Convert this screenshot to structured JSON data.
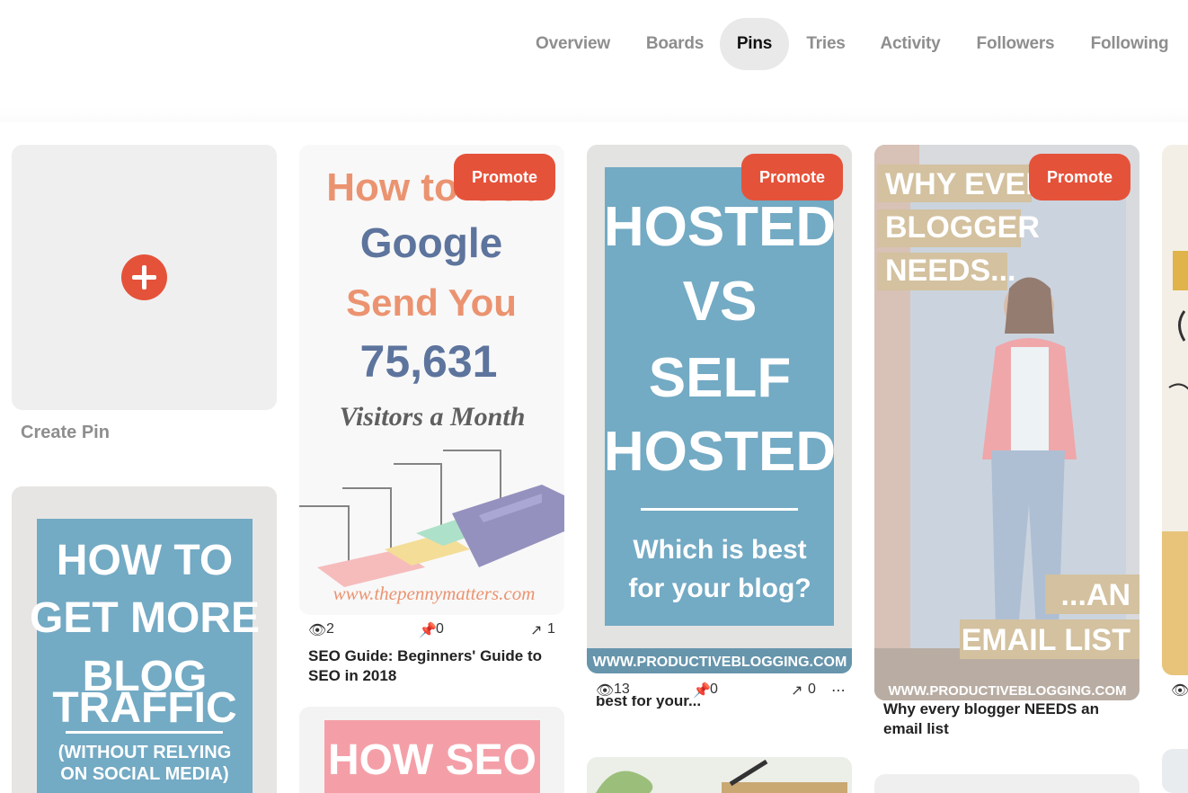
{
  "nav": {
    "tabs": [
      {
        "label": "Overview"
      },
      {
        "label": "Boards"
      },
      {
        "label": "Pins"
      },
      {
        "label": "Tries"
      },
      {
        "label": "Activity"
      },
      {
        "label": "Followers"
      },
      {
        "label": "Following"
      }
    ],
    "active": "Pins"
  },
  "create_pin": {
    "label": "Create Pin"
  },
  "colors": {
    "accent": "#e5523a",
    "tab_active_bg": "#e9e9e9"
  },
  "pins": [
    {
      "promote": "Promote",
      "image_text": [
        "How to Use",
        "Google",
        "Send You",
        "75,631",
        "Visitors a Month",
        "www.thepennymatters.com"
      ],
      "stats": {
        "views": "2",
        "saves": "0",
        "clicks": "1"
      },
      "title": "SEO Guide: Beginners' Guide to SEO in 2018"
    },
    {
      "promote": "Promote",
      "image_text": [
        "HOSTED",
        "VS",
        "SELF",
        "HOSTED",
        "Which is best",
        "for your blog?",
        "WWW.PRODUCTIVEBLOGGING.COM"
      ],
      "stats": {
        "views": "13",
        "saves": "0",
        "clicks": "0"
      },
      "title": "best for your..."
    },
    {
      "promote": "Promote",
      "image_text": [
        "WHY EVERY",
        "BLOGGER",
        "NEEDS...",
        "...AN",
        "EMAIL LIST",
        "WWW.PRODUCTIVEBLOGGING.COM"
      ],
      "title": "Why every blogger NEEDS an email list"
    },
    {
      "image_text": [
        "HOW TO",
        "GET MORE",
        "BLOG",
        "TRAFFIC",
        "(WITHOUT RELYING",
        "ON SOCIAL MEDIA)"
      ]
    },
    {
      "image_text": [
        "HOW SEO"
      ]
    }
  ]
}
